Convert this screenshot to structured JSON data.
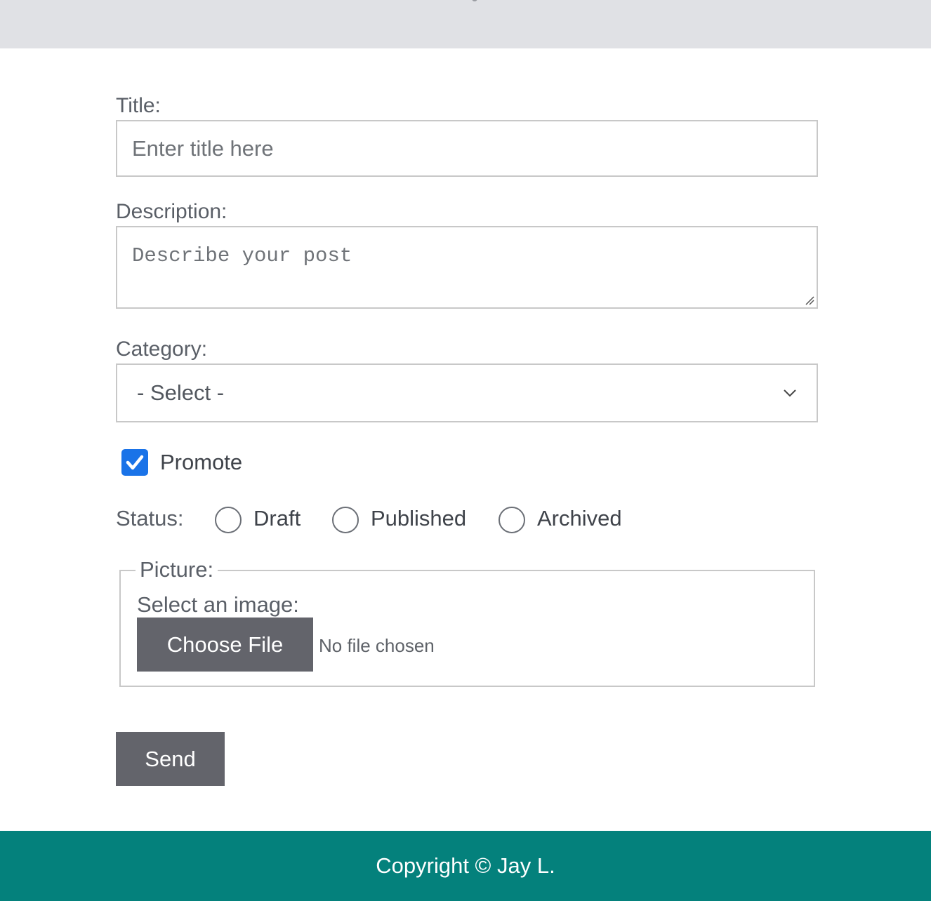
{
  "form": {
    "title_label": "Title:",
    "title_placeholder": "Enter title here",
    "description_label": "Description:",
    "description_placeholder": "Describe your post",
    "category_label": "Category:",
    "category_selected": "- Select -",
    "promote_label": "Promote",
    "promote_checked": true,
    "status_label": "Status:",
    "status_options": [
      "Draft",
      "Published",
      "Archived"
    ],
    "picture_legend": "Picture:",
    "select_image_label": "Select an image:",
    "choose_file_label": "Choose File",
    "no_file_text": "No file chosen",
    "send_label": "Send"
  },
  "footer": {
    "copyright": "Copyright © Jay L."
  },
  "colors": {
    "checkbox_accent": "#1a73e8",
    "button_bg": "#63646b",
    "footer_bg": "#04817c",
    "topbar_bg": "#e0e1e5"
  },
  "icons": {
    "checkbox": "check-icon",
    "select": "chevron-down-icon",
    "textarea": "resize-grip-icon"
  }
}
